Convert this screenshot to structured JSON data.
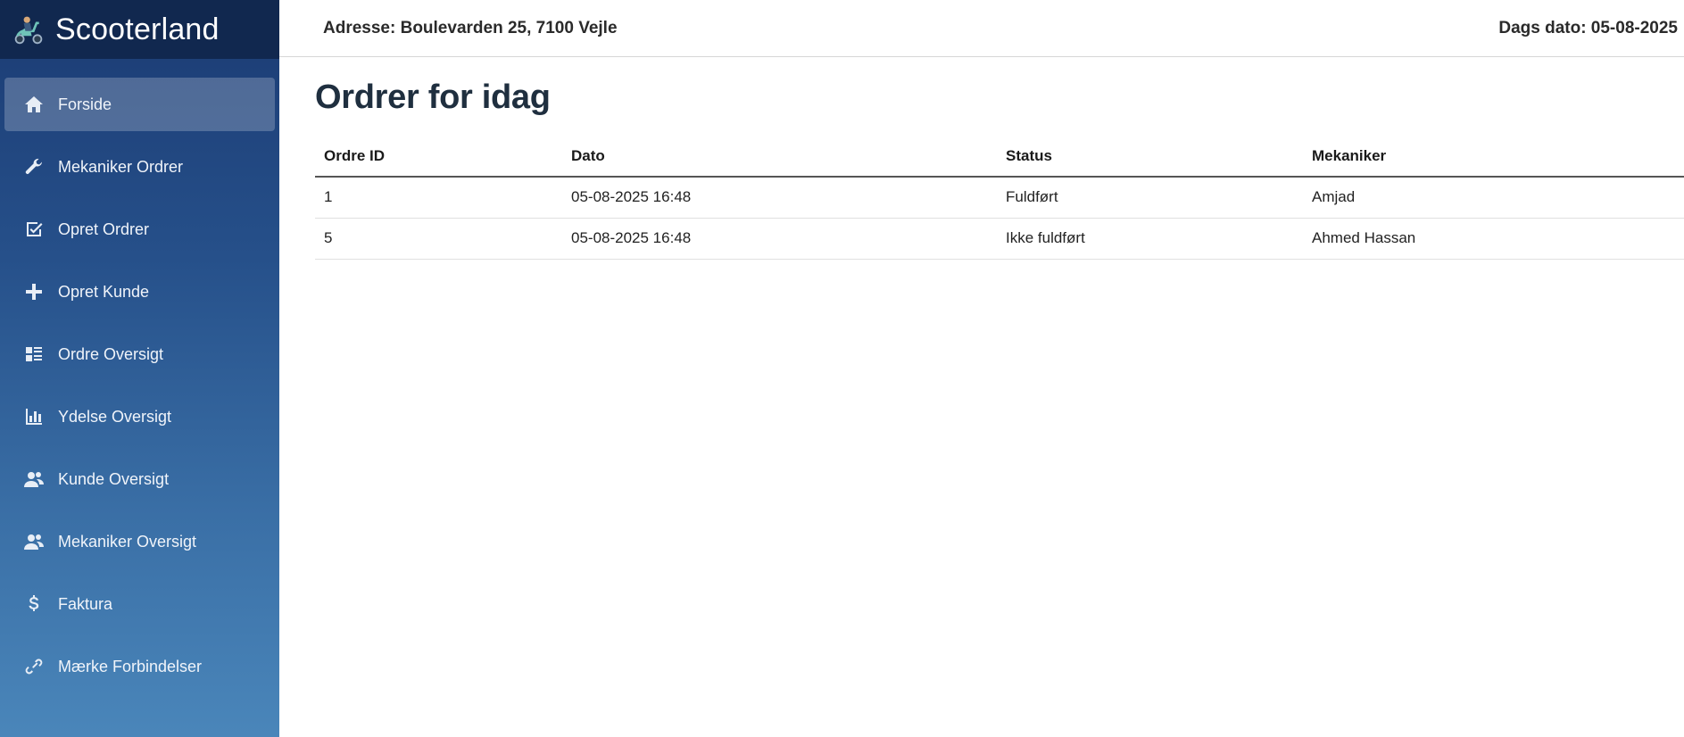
{
  "brand": {
    "name": "Scooterland",
    "logo_icon": "scooter-icon"
  },
  "sidebar": {
    "items": [
      {
        "label": "Forside",
        "icon": "home-icon",
        "active": true
      },
      {
        "label": "Mekaniker Ordrer",
        "icon": "wrench-icon"
      },
      {
        "label": "Opret Ordrer",
        "icon": "checkbox-edit-icon"
      },
      {
        "label": "Opret Kunde",
        "icon": "plus-icon"
      },
      {
        "label": "Ordre Oversigt",
        "icon": "list-view-icon"
      },
      {
        "label": "Ydelse Oversigt",
        "icon": "bar-chart-icon"
      },
      {
        "label": "Kunde Oversigt",
        "icon": "users-icon"
      },
      {
        "label": "Mekaniker Oversigt",
        "icon": "users-icon"
      },
      {
        "label": "Faktura",
        "icon": "dollar-icon"
      },
      {
        "label": "Mærke Forbindelser",
        "icon": "link-icon"
      }
    ]
  },
  "header": {
    "address": "Adresse: Boulevarden 25, 7100 Vejle",
    "date": "Dags dato: 05-08-2025"
  },
  "main": {
    "title": "Ordrer for idag",
    "table": {
      "columns": [
        "Ordre ID",
        "Dato",
        "Status",
        "Mekaniker"
      ],
      "rows": [
        [
          "1",
          "05-08-2025 16:48",
          "Fuldført",
          "Amjad"
        ],
        [
          "5",
          "05-08-2025 16:48",
          "Ikke fuldført",
          "Ahmed Hassan"
        ]
      ]
    }
  }
}
